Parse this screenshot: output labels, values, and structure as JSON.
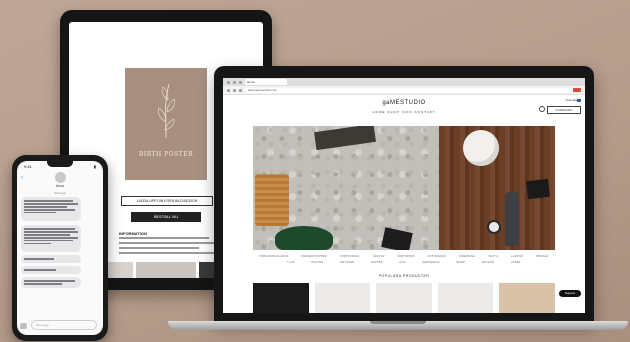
{
  "tablet": {
    "poster_caption": "BIRTH POSTER",
    "upload_label": "LADDA UPP DIN EGEN BILD/DESIGN",
    "order_label": "BESTÄLL NU",
    "info_title": "INFORMATION"
  },
  "laptop": {
    "browser_tab": "Home",
    "url": "www.gamestudio.com",
    "site_logo": "gaMESTUDIO",
    "nav": "HOME SHOP INFO KONTAKT",
    "lang": "Svenska",
    "cart": "KUNDVAGN",
    "categories_row1": [
      "FÖRVARINGSLÅDOR",
      "PRESENTPAPPER",
      "KORTFODRAL",
      "VÄSKOR",
      "SKRIVBORD",
      "FOTORAMAR",
      "INREDNING",
      "TEXTIL",
      "LAMPOR",
      "BÖCKER"
    ],
    "categories_row2": [
      "LJUS",
      "DOFTER",
      "SMYCKEN",
      "PAPPER",
      "KÖK",
      "SERVERING",
      "BORD",
      "KRUKOR",
      "VASER"
    ],
    "popular_title": "POPULÄRA PRODUKTER",
    "support_label": "Support"
  },
  "phone": {
    "clock": "9:41",
    "contact": "Anna",
    "timestamp": "iMessage",
    "input_placeholder": "iMessage"
  },
  "colors": {
    "background": "#b9a191",
    "poster": "#a88f80",
    "device": "#161616"
  }
}
